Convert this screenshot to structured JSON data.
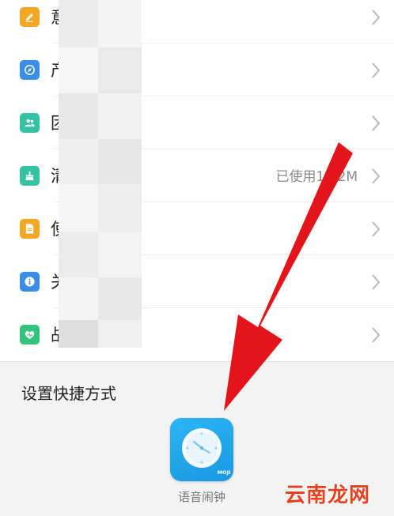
{
  "settings_list": {
    "items": [
      {
        "label": "意",
        "value": "",
        "icon": "edit-icon",
        "color": "#f5a623"
      },
      {
        "label": "产",
        "value": "",
        "icon": "compass-icon",
        "color": "#3a8ee6"
      },
      {
        "label": "团",
        "value": "",
        "icon": "people-icon",
        "color": "#33c3a4"
      },
      {
        "label": "清",
        "value": "已使用17.2M",
        "icon": "broom-icon",
        "color": "#35c3a2"
      },
      {
        "label": "使",
        "value": "",
        "icon": "document-icon",
        "color": "#f5a623"
      },
      {
        "label": "关",
        "value": "",
        "icon": "info-icon",
        "color": "#3a8ee6"
      },
      {
        "label": "战",
        "value": "",
        "icon": "heart-icon",
        "color": "#33c37c"
      }
    ]
  },
  "shortcut_panel": {
    "title": "设置快捷方式",
    "app": {
      "name": "语音闹钟",
      "icon": "alarm-clock-icon",
      "badge": "MOJI",
      "color": "#1fa3ea"
    }
  },
  "watermark": "云南龙网",
  "colors": {
    "arrow": "#e4141b",
    "chevron": "#b9b9b9"
  }
}
